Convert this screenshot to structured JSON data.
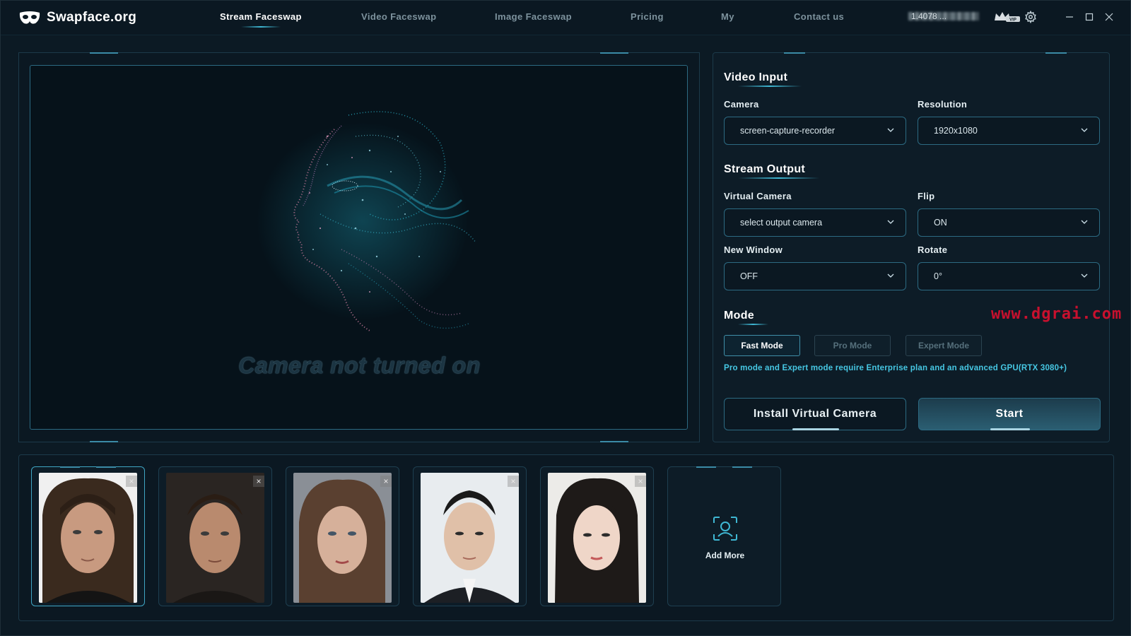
{
  "app": {
    "name": "Swapface.org"
  },
  "nav": [
    {
      "label": "Stream Faceswap",
      "active": true
    },
    {
      "label": "Video Faceswap",
      "active": false
    },
    {
      "label": "Image Faceswap",
      "active": false
    },
    {
      "label": "Pricing",
      "active": false
    },
    {
      "label": "My",
      "active": false
    },
    {
      "label": "Contact us",
      "active": false
    }
  ],
  "user": {
    "name_masked": "1.4078 ...",
    "badge": "VIP"
  },
  "preview": {
    "status_text": "Camera not turned on"
  },
  "video_input": {
    "title": "Video Input",
    "camera_label": "Camera",
    "camera_value": "screen-capture-recorder",
    "resolution_label": "Resolution",
    "resolution_value": "1920x1080"
  },
  "stream_output": {
    "title": "Stream Output",
    "virtual_camera_label": "Virtual Camera",
    "virtual_camera_value": "select output camera",
    "flip_label": "Flip",
    "flip_value": "ON",
    "new_window_label": "New Window",
    "new_window_value": "OFF",
    "rotate_label": "Rotate",
    "rotate_value": "0°"
  },
  "mode": {
    "title": "Mode",
    "options": [
      {
        "label": "Fast Mode",
        "active": true
      },
      {
        "label": "Pro Mode",
        "active": false
      },
      {
        "label": "Expert Mode",
        "active": false
      }
    ],
    "note": "Pro mode and Expert mode require Enterprise plan and an advanced GPU(RTX 3080+)"
  },
  "actions": {
    "install_label": "Install Virtual Camera",
    "start_label": "Start"
  },
  "watermark": "www.dgrai.com",
  "faces": {
    "count": 5,
    "selected_index": 0,
    "add_more_label": "Add More"
  },
  "colors": {
    "accent": "#3fb8d4",
    "note": "#46c7e3",
    "background": "#0c1a24",
    "watermark": "#c8102e"
  }
}
